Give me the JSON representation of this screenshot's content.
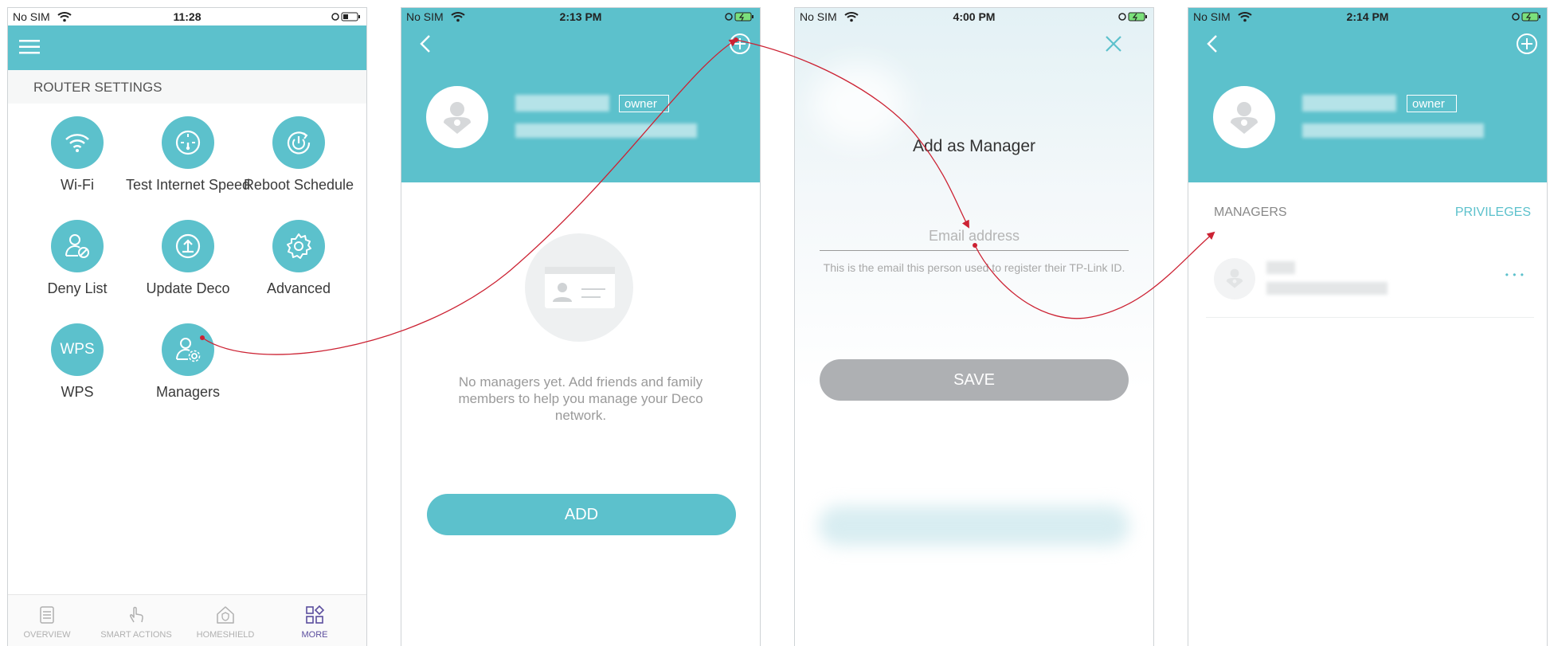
{
  "screen1": {
    "status": {
      "carrier": "No SIM",
      "time": "11:28"
    },
    "section_title": "ROUTER SETTINGS",
    "items": [
      {
        "label": "Wi-Fi",
        "icon": "wifi-icon"
      },
      {
        "label": "Test Internet Speed",
        "icon": "speedometer-icon"
      },
      {
        "label": "Reboot Schedule",
        "icon": "reboot-icon"
      },
      {
        "label": "Deny List",
        "icon": "deny-user-icon"
      },
      {
        "label": "Update Deco",
        "icon": "upload-icon"
      },
      {
        "label": "Advanced",
        "icon": "gear-icon"
      },
      {
        "label": "WPS",
        "icon": "wps-icon"
      },
      {
        "label": "Managers",
        "icon": "managers-icon"
      }
    ],
    "wps_icon_text": "WPS",
    "tabs": [
      {
        "label": "OVERVIEW"
      },
      {
        "label": "SMART ACTIONS"
      },
      {
        "label": "HOMESHIELD"
      },
      {
        "label": "MORE"
      }
    ]
  },
  "screen2": {
    "status": {
      "carrier": "No SIM",
      "time": "2:13 PM"
    },
    "owner_tag": "owner",
    "empty_text": "No managers yet. Add friends and family members to help you manage your Deco network.",
    "add_button": "ADD"
  },
  "screen3": {
    "status": {
      "carrier": "No SIM",
      "time": "4:00 PM"
    },
    "title": "Add as Manager",
    "email_placeholder": "Email address",
    "hint": "This is the email this person used to register their TP-Link ID.",
    "save_button": "SAVE"
  },
  "screen4": {
    "status": {
      "carrier": "No SIM",
      "time": "2:14 PM"
    },
    "owner_tag": "owner",
    "managers_header": "MANAGERS",
    "privileges_link": "PRIVILEGES",
    "more_glyph": "• • •"
  },
  "colors": {
    "teal": "#5cc1cc",
    "arrow": "#cc2233",
    "save_gray": "#aeb0b3"
  }
}
